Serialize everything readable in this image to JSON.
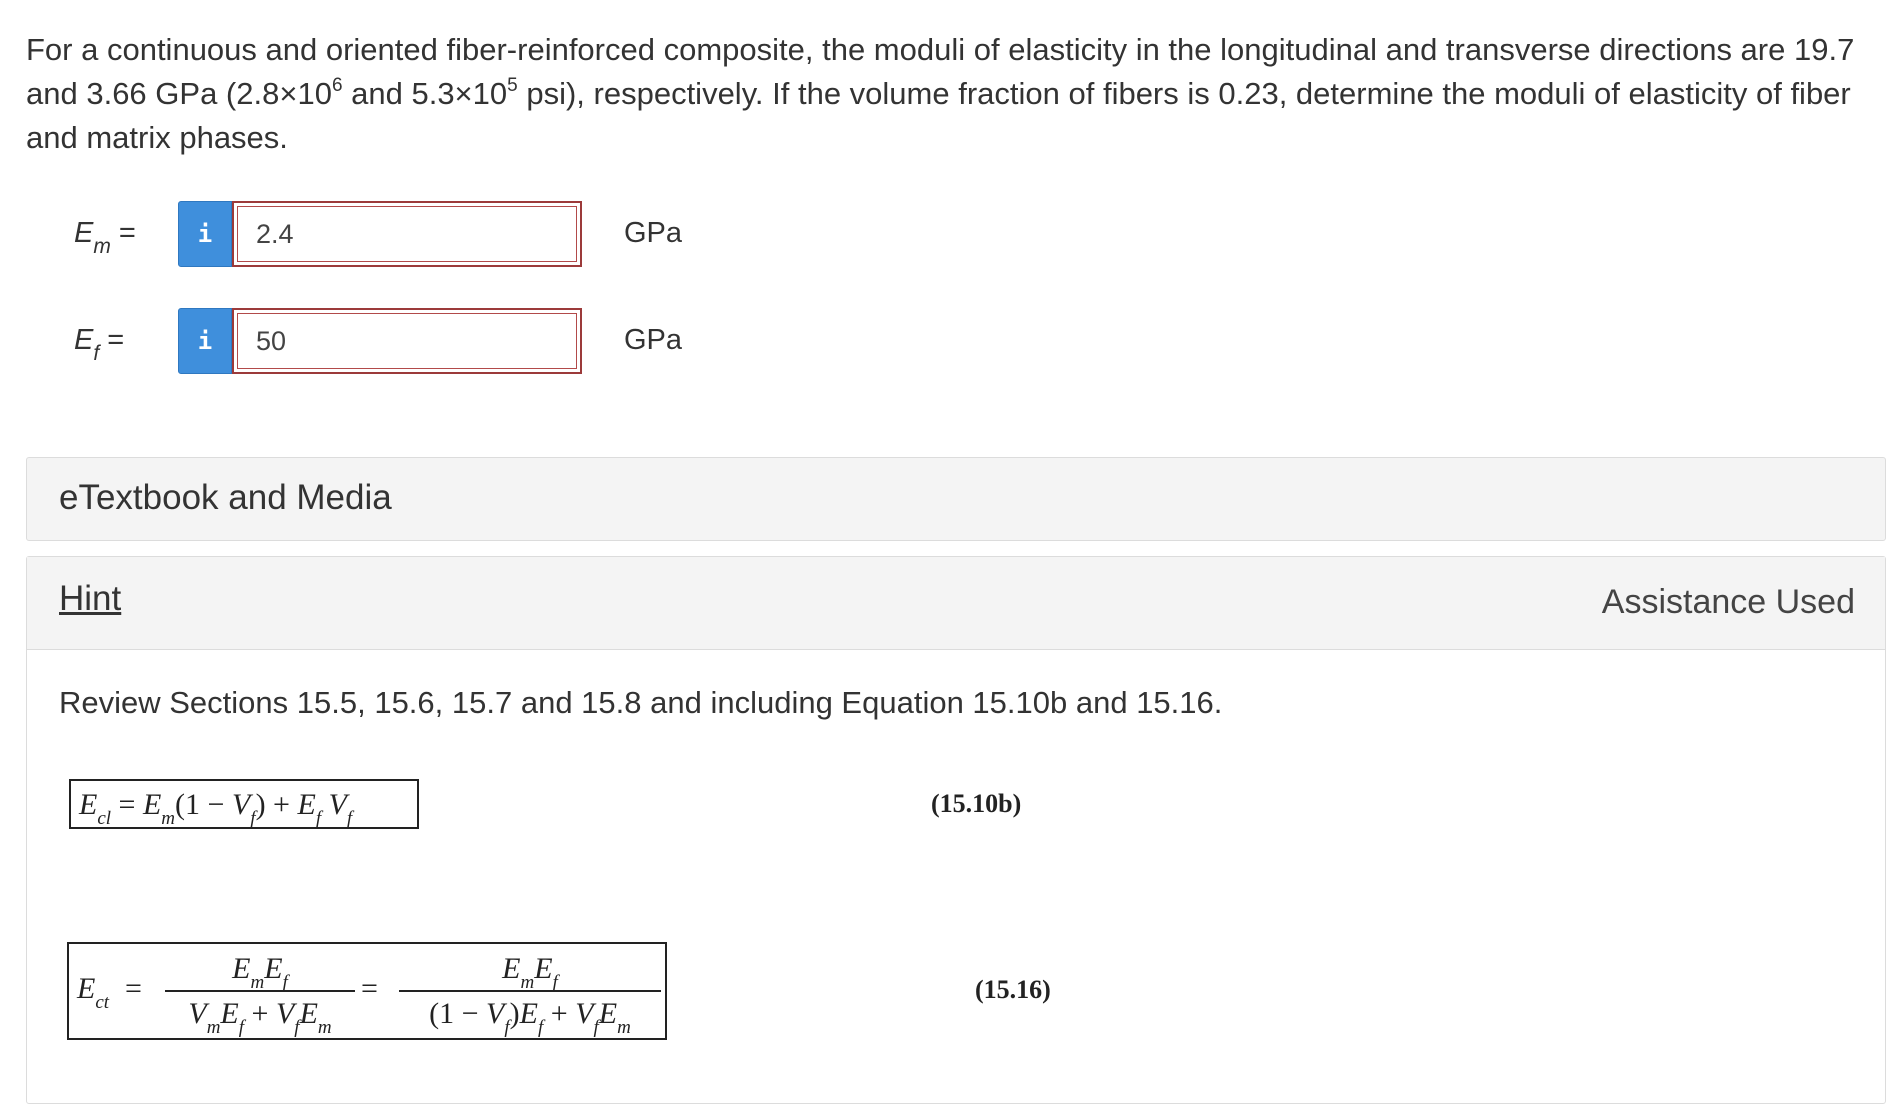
{
  "question": {
    "part1": "For a continuous and oriented fiber-reinforced composite, the moduli of elasticity in the longitudinal and transverse directions are 19.7 and 3.66 GPa (2.8×10",
    "exp1": "6",
    "part2": " and 5.3×10",
    "exp2": "5",
    "part3": " psi), respectively. If the volume fraction of fibers is 0.23, determine the moduli of elasticity of fiber and matrix phases."
  },
  "answers": [
    {
      "label_main": "E",
      "label_sub": "m",
      "equals": "=",
      "info_icon": "i",
      "value": "2.4",
      "unit": "GPa"
    },
    {
      "label_main": "E",
      "label_sub": "f",
      "equals": "=",
      "info_icon": "i",
      "value": "50",
      "unit": "GPa"
    }
  ],
  "etextbook": {
    "title": "eTextbook and Media"
  },
  "hint": {
    "link_label": "Hint",
    "assistance": "Assistance Used",
    "text": "Review Sections 15.5, 15.6, 15.7 and 15.8 and including Equation 15.10b and 15.16.",
    "eq1_number": "(15.10b)",
    "eq2_number": "(15.16)"
  },
  "colors": {
    "info_button": "#3f8fdc",
    "input_border_error": "#9c3a3a",
    "panel_background": "#f4f4f4"
  },
  "icons": {
    "info": "info-icon"
  }
}
